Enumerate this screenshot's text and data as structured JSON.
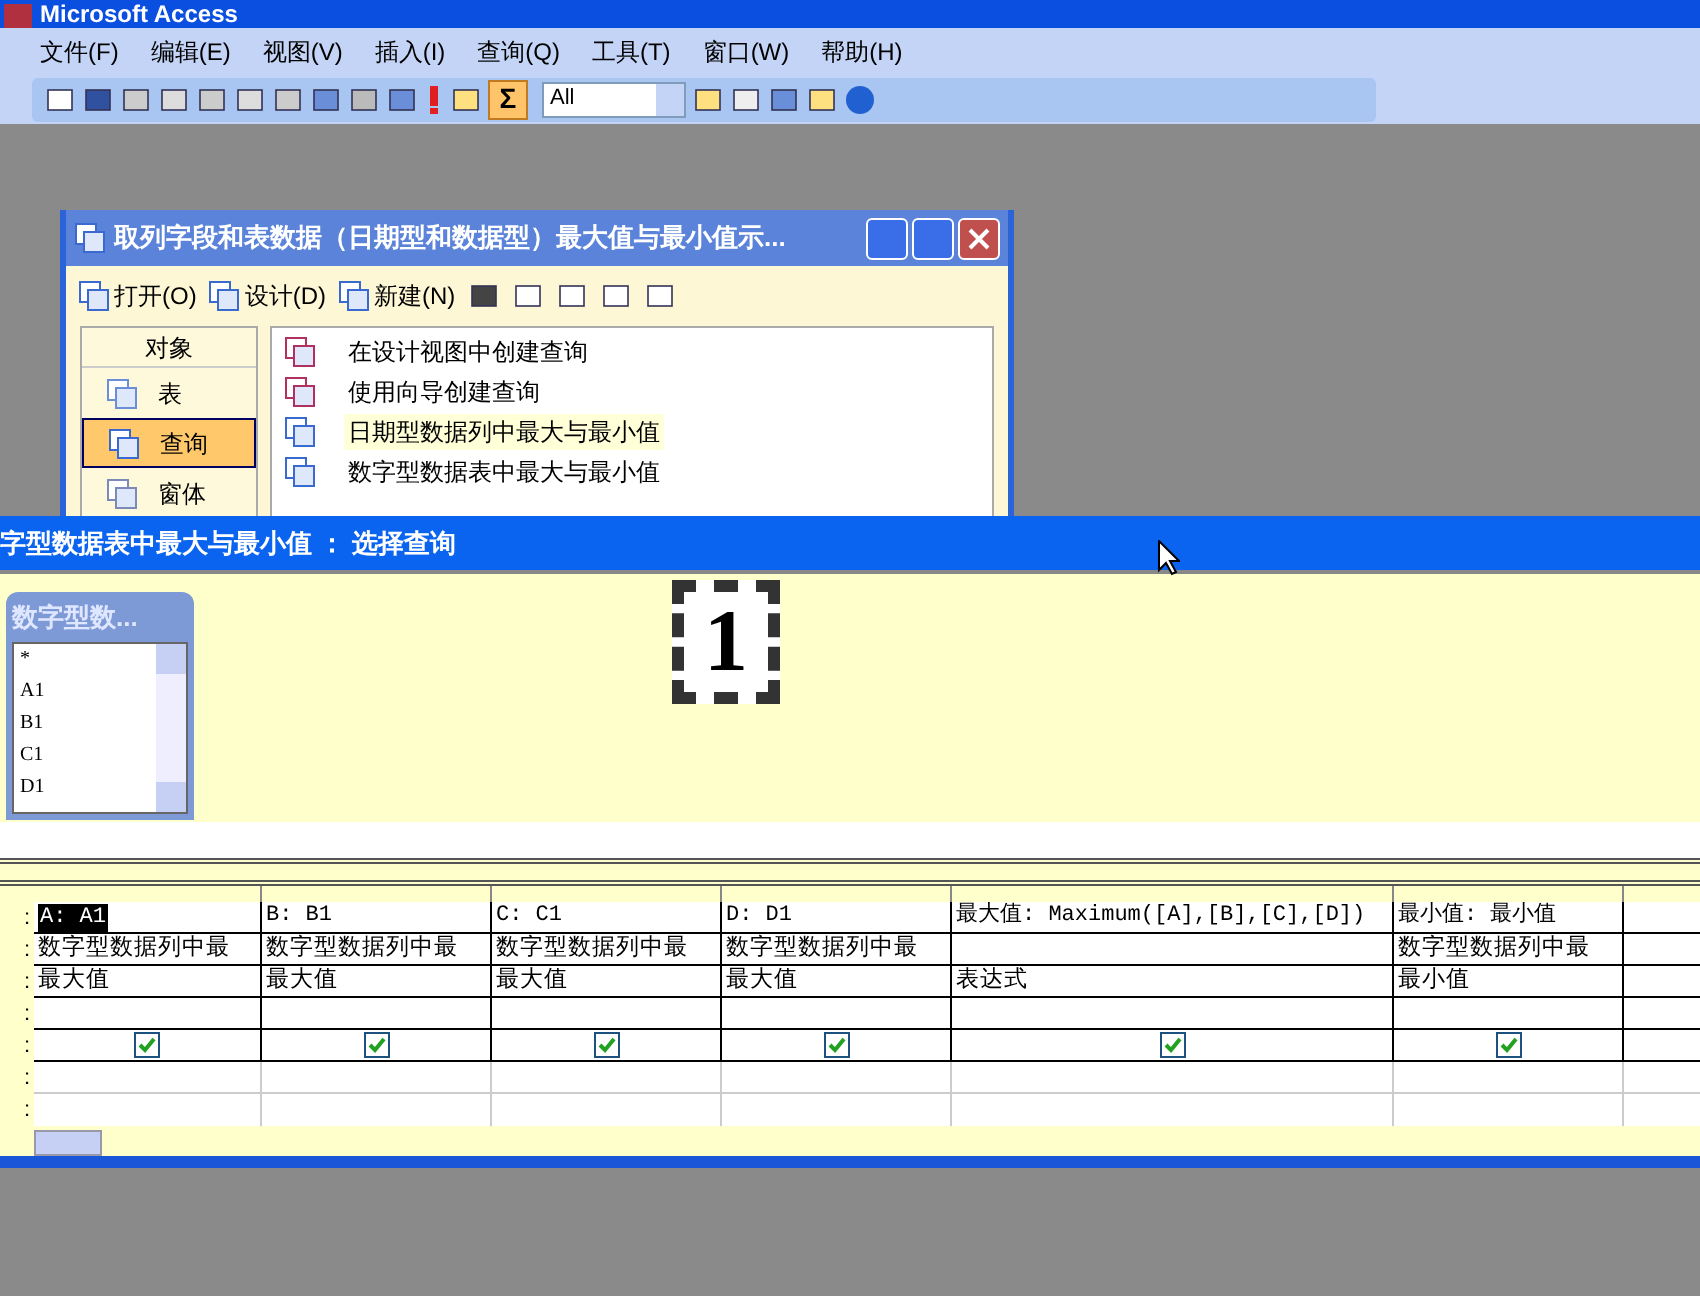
{
  "app_title": "Microsoft Access",
  "menu": [
    "文件(F)",
    "编辑(E)",
    "视图(V)",
    "插入(I)",
    "查询(Q)",
    "工具(T)",
    "窗口(W)",
    "帮助(H)"
  ],
  "toolbar": {
    "totals_symbol": "Σ",
    "totals_on": true,
    "top_values": "All"
  },
  "db_window": {
    "title": "取列字段和表数据（日期型和数据型）最大值与最小值示...",
    "actions": [
      "打开(O)",
      "设计(D)",
      "新建(N)"
    ],
    "objects_header": "对象",
    "objects": [
      {
        "label": "表",
        "kind": "table",
        "selected": false
      },
      {
        "label": "查询",
        "kind": "query",
        "selected": true
      },
      {
        "label": "窗体",
        "kind": "form",
        "selected": false
      }
    ],
    "items": [
      {
        "label": "在设计视图中创建查询",
        "kind": "wizard",
        "selected": false
      },
      {
        "label": "使用向导创建查询",
        "kind": "wizard",
        "selected": false
      },
      {
        "label": "日期型数据列中最大与最小值",
        "kind": "query",
        "selected": true
      },
      {
        "label": "数字型数据表中最大与最小值",
        "kind": "query",
        "selected": false
      }
    ]
  },
  "query_window": {
    "title": "字型数据表中最大与最小值 ： 选择查询",
    "field_list": {
      "title": "数字型数...",
      "fields": [
        "*",
        "A1",
        "B1",
        "C1",
        "D1"
      ]
    },
    "callout_number": "1",
    "row_marks": [
      ":",
      ":",
      ":",
      ":",
      ":",
      ":",
      ":"
    ],
    "columns": [
      {
        "field": "A: A1",
        "table": "数字型数据列中最",
        "total": "最大值",
        "show": true,
        "selected": true
      },
      {
        "field": "B: B1",
        "table": "数字型数据列中最",
        "total": "最大值",
        "show": true,
        "selected": false
      },
      {
        "field": "C: C1",
        "table": "数字型数据列中最",
        "total": "最大值",
        "show": true,
        "selected": false
      },
      {
        "field": "D: D1",
        "table": "数字型数据列中最",
        "total": "最大值",
        "show": true,
        "selected": false
      },
      {
        "field": "最大值: Maximum([A],[B],[C],[D])",
        "total": "表达式",
        "show": true,
        "selected": false
      },
      {
        "field": "最小值: 最小值",
        "table": "数字型数据列中最",
        "total": "最小值",
        "show": true,
        "selected": false
      },
      {
        "show": false,
        "selected": false
      }
    ]
  }
}
